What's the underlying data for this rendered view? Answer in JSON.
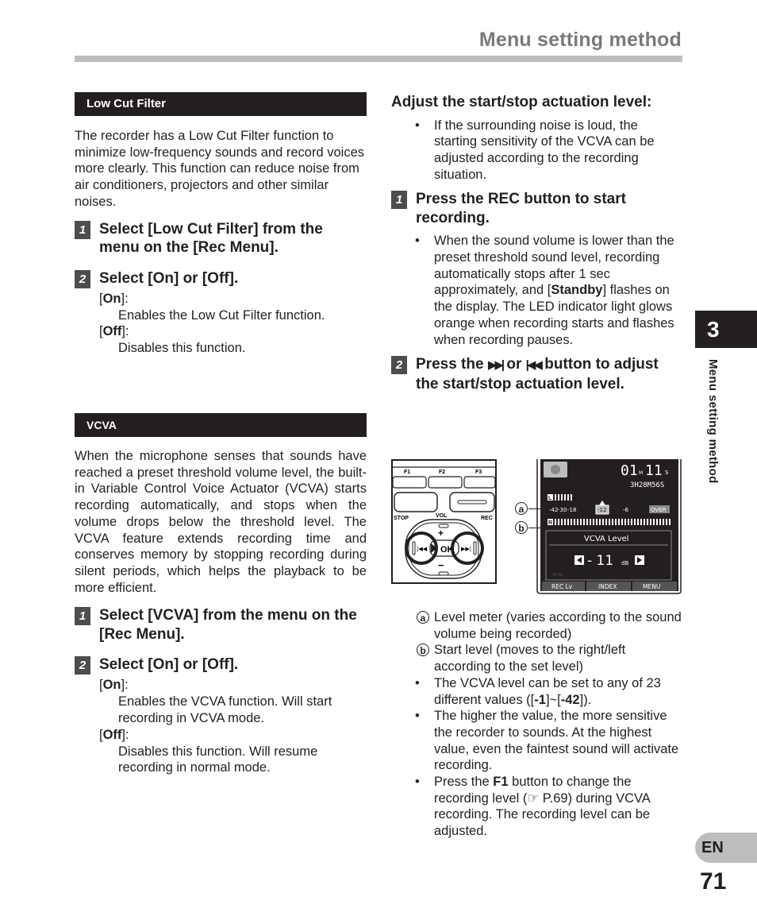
{
  "header": {
    "title": "Menu setting method"
  },
  "side": {
    "chapter_number": "3",
    "chapter_label": "Menu setting method",
    "language": "EN",
    "page_number": "71"
  },
  "low_cut": {
    "section_title": "Low Cut Filter",
    "intro": "The recorder has a Low Cut Filter function to minimize low-frequency sounds and record voices more clearly. This function can reduce noise from air conditioners, projectors and other similar noises.",
    "steps": [
      {
        "num": "1",
        "text": "Select [Low Cut Filter] from the menu on the [Rec Menu]."
      },
      {
        "num": "2",
        "text": "Select [On] or [Off]."
      }
    ],
    "options": [
      {
        "label": "On",
        "desc": "Enables the Low Cut Filter function."
      },
      {
        "label": "Off",
        "desc": "Disables this function."
      }
    ]
  },
  "vcva": {
    "section_title": "VCVA",
    "intro": "When the microphone senses that sounds have reached a preset threshold volume level, the built-in Variable Control Voice Actuator (VCVA) starts recording automatically, and stops when the volume drops below the threshold level. The VCVA feature extends recording time and conserves memory by stopping recording during silent periods, which helps the playback to be more efficient.",
    "steps": [
      {
        "num": "1",
        "text": "Select [VCVA] from the menu on the [Rec Menu]."
      },
      {
        "num": "2",
        "text": "Select [On] or [Off]."
      }
    ],
    "options": [
      {
        "label": "On",
        "desc": "Enables the VCVA function. Will start recording in VCVA mode."
      },
      {
        "label": "Off",
        "desc": "Disables this function. Will resume recording in normal mode."
      }
    ]
  },
  "adjust": {
    "heading": "Adjust the start/stop actuation level:",
    "intro_bullet": "If the surrounding noise is loud, the starting sensitivity of the VCVA can be adjusted according to the recording situation.",
    "step1": {
      "num": "1",
      "text": "Press the REC button to start recording."
    },
    "step1_bullet_pre": "When the sound volume is lower than the preset threshold sound level, recording automatically stops after 1 sec approximately, and [",
    "step1_bullet_bold": "Standby",
    "step1_bullet_post": "] flashes on the display. The LED indicator light glows orange when recording starts and flashes when recording pauses.",
    "step2": {
      "num": "2",
      "pre": "Press the ",
      "icon1": "▶▶|",
      "mid": " or ",
      "icon2": "|◀◀",
      "post": " button to adjust the start/stop actuation level."
    },
    "callouts": [
      {
        "mark": "a",
        "text": "Level meter (varies according to the sound volume being recorded)"
      },
      {
        "mark": "b",
        "text": "Start level (moves to the right/left according to the set level)"
      }
    ],
    "bullets": [
      {
        "pre": "The VCVA level can be set to any of 23 different values ([",
        "b1": "-1",
        "mid": "]~[",
        "b2": "-42",
        "post": "])."
      },
      {
        "text": "The higher the value, the more sensitive the recorder to sounds. At the highest value, even the faintest sound will activate recording."
      },
      {
        "pre": "Press the ",
        "bold": "F1",
        "post": " button to change the recording level (☞ P.69) during VCVA recording. The recording level can be adjusted."
      }
    ]
  },
  "device_figure": {
    "f_keys": [
      "F1",
      "F2",
      "F3"
    ],
    "stop_label": "STOP",
    "vol_label": "VOL",
    "rec_label": "REC",
    "ok_label": "OK",
    "plus": "+",
    "minus": "−"
  },
  "screen_figure": {
    "time_main": "01M11S",
    "time_min": "01",
    "time_min_unit": "M",
    "time_sec": "11",
    "time_sec_unit": "S",
    "remaining": "3H28M56S",
    "scale": [
      "-42",
      "-30",
      "-18",
      "-12",
      "-6"
    ],
    "over": "OVER",
    "channel_l": "L",
    "channel_r": "R",
    "level_title": "VCVA Level",
    "level_value": "- 11",
    "level_unit": "dB",
    "vcva_indicator": "VCVA",
    "softkeys": [
      "REC Lv",
      "INDEX",
      "MENU"
    ],
    "callout_a": "a",
    "callout_b": "b"
  }
}
